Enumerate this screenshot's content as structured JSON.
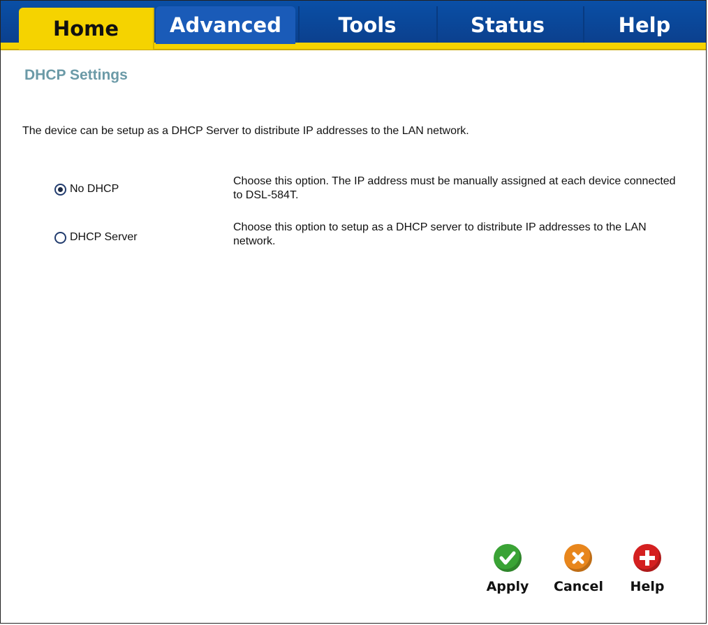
{
  "tabs": [
    {
      "label": "Home"
    },
    {
      "label": "Advanced"
    },
    {
      "label": "Tools"
    },
    {
      "label": "Status"
    },
    {
      "label": "Help"
    }
  ],
  "active_tab": "Home",
  "page": {
    "title": "DHCP Settings",
    "intro": "The device can be setup as a DHCP Server to distribute IP addresses to the LAN network."
  },
  "options": [
    {
      "label": "No DHCP",
      "selected": true,
      "description": "Choose this option. The IP address must be manually assigned at each device connected to DSL-584T."
    },
    {
      "label": "DHCP Server",
      "selected": false,
      "description": "Choose this option to setup as a DHCP server to distribute IP addresses to the LAN network."
    }
  ],
  "actions": {
    "apply": "Apply",
    "cancel": "Cancel",
    "help": "Help"
  },
  "colors": {
    "tab_blue": "#0b3f8c",
    "tab_yellow": "#f5d300",
    "title_teal": "#6b9aa7",
    "apply_green": "#3aa335",
    "cancel_orange": "#e8861c",
    "help_red": "#d42020"
  },
  "icons": {
    "apply": "check-icon",
    "cancel": "x-icon",
    "help": "plus-icon"
  }
}
